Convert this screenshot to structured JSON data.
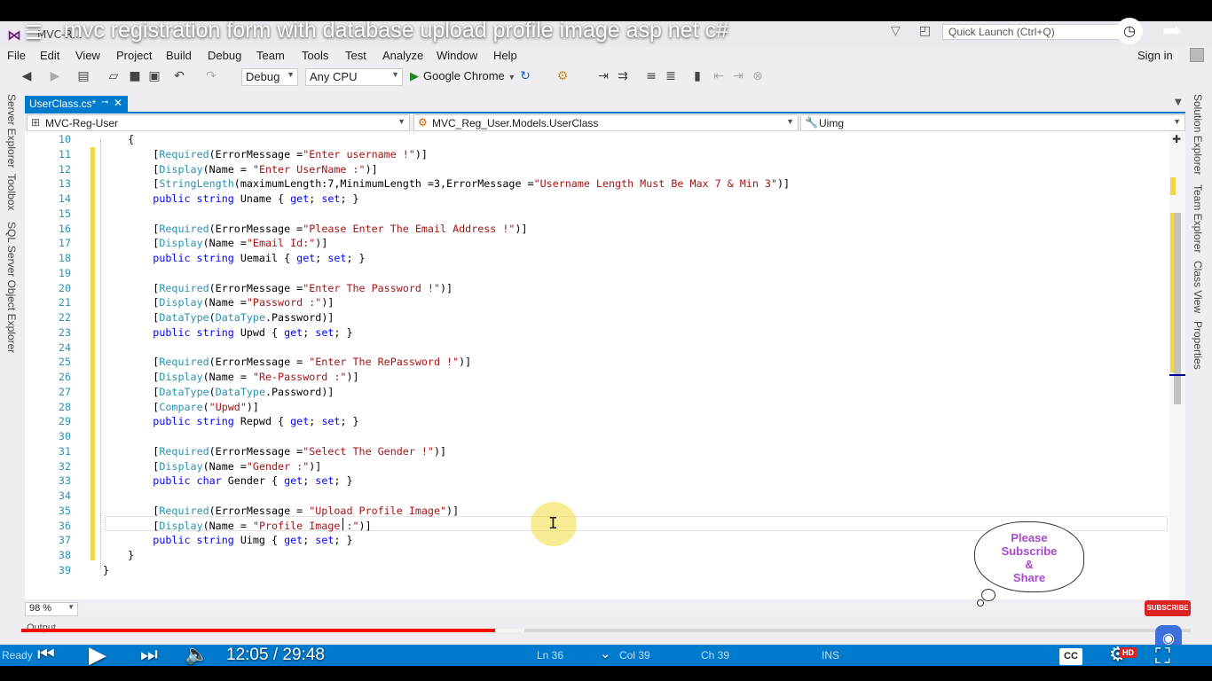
{
  "video": {
    "title": "mvc registration form with database upload profile image asp net c#",
    "current_time": "12:05",
    "duration": "29:48",
    "time_display": "12:05 / 29:48",
    "progress_fraction": 0.4055,
    "buffered_fraction": 0.43,
    "hd_label": "HD",
    "cc_label": "CC",
    "subscribe_label": "SUBSCRIBE"
  },
  "window": {
    "title_fragment": "MVC-R...",
    "quick_launch_placeholder": "Quick Launch (Ctrl+Q)",
    "sign_in": "Sign in"
  },
  "menu": [
    "File",
    "Edit",
    "View",
    "Project",
    "Build",
    "Debug",
    "Team",
    "Tools",
    "Test",
    "Analyze",
    "Window",
    "Help"
  ],
  "toolbar": {
    "config": "Debug",
    "platform": "Any CPU",
    "run_target": "Google Chrome"
  },
  "left_tabs": [
    "Server Explorer",
    "Toolbox",
    "SQL Server Object Explorer"
  ],
  "right_tabs": [
    "Solution Explorer",
    "Team Explorer",
    "Class View",
    "Properties"
  ],
  "document_tab": {
    "label": "UserClass.cs*"
  },
  "navigation_bar": {
    "project": "MVC-Reg-User",
    "type": "MVC_Reg_User.Models.UserClass",
    "member": "Uimg"
  },
  "code_lines": [
    {
      "n": "10",
      "tokens": [
        {
          "t": "tx",
          "v": "    {"
        }
      ]
    },
    {
      "n": "11",
      "tokens": [
        {
          "t": "tx",
          "v": "        ["
        },
        {
          "t": "ty",
          "v": "Required"
        },
        {
          "t": "tx",
          "v": "(ErrorMessage ="
        },
        {
          "t": "st",
          "v": "\"Enter username !\""
        },
        {
          "t": "tx",
          "v": ")]"
        }
      ]
    },
    {
      "n": "12",
      "tokens": [
        {
          "t": "tx",
          "v": "        ["
        },
        {
          "t": "ty",
          "v": "Display"
        },
        {
          "t": "tx",
          "v": "(Name = "
        },
        {
          "t": "st",
          "v": "\"Enter UserName :\""
        },
        {
          "t": "tx",
          "v": ")]"
        }
      ]
    },
    {
      "n": "13",
      "tokens": [
        {
          "t": "tx",
          "v": "        ["
        },
        {
          "t": "ty",
          "v": "StringLength"
        },
        {
          "t": "tx",
          "v": "(maximumLength:7,MinimumLength =3,ErrorMessage ="
        },
        {
          "t": "st",
          "v": "\"Username Length Must Be Max 7 & Min 3\""
        },
        {
          "t": "tx",
          "v": ")]"
        }
      ]
    },
    {
      "n": "14",
      "tokens": [
        {
          "t": "tx",
          "v": "        "
        },
        {
          "t": "kw",
          "v": "public string"
        },
        {
          "t": "tx",
          "v": " Uname { "
        },
        {
          "t": "kw",
          "v": "get"
        },
        {
          "t": "tx",
          "v": "; "
        },
        {
          "t": "kw",
          "v": "set"
        },
        {
          "t": "tx",
          "v": "; }"
        }
      ]
    },
    {
      "n": "15",
      "tokens": []
    },
    {
      "n": "16",
      "tokens": [
        {
          "t": "tx",
          "v": "        ["
        },
        {
          "t": "ty",
          "v": "Required"
        },
        {
          "t": "tx",
          "v": "(ErrorMessage ="
        },
        {
          "t": "st",
          "v": "\"Please Enter The Email Address !\""
        },
        {
          "t": "tx",
          "v": ")]"
        }
      ]
    },
    {
      "n": "17",
      "tokens": [
        {
          "t": "tx",
          "v": "        ["
        },
        {
          "t": "ty",
          "v": "Display"
        },
        {
          "t": "tx",
          "v": "(Name ="
        },
        {
          "t": "st",
          "v": "\"Email Id:\""
        },
        {
          "t": "tx",
          "v": ")]"
        }
      ]
    },
    {
      "n": "18",
      "tokens": [
        {
          "t": "tx",
          "v": "        "
        },
        {
          "t": "kw",
          "v": "public string"
        },
        {
          "t": "tx",
          "v": " Uemail { "
        },
        {
          "t": "kw",
          "v": "get"
        },
        {
          "t": "tx",
          "v": "; "
        },
        {
          "t": "kw",
          "v": "set"
        },
        {
          "t": "tx",
          "v": "; }"
        }
      ]
    },
    {
      "n": "19",
      "tokens": []
    },
    {
      "n": "20",
      "tokens": [
        {
          "t": "tx",
          "v": "        ["
        },
        {
          "t": "ty",
          "v": "Required"
        },
        {
          "t": "tx",
          "v": "(ErrorMessage ="
        },
        {
          "t": "st",
          "v": "\"Enter The Password !\""
        },
        {
          "t": "tx",
          "v": ")]"
        }
      ]
    },
    {
      "n": "21",
      "tokens": [
        {
          "t": "tx",
          "v": "        ["
        },
        {
          "t": "ty",
          "v": "Display"
        },
        {
          "t": "tx",
          "v": "(Name ="
        },
        {
          "t": "st",
          "v": "\"Password :\""
        },
        {
          "t": "tx",
          "v": ")]"
        }
      ]
    },
    {
      "n": "22",
      "tokens": [
        {
          "t": "tx",
          "v": "        ["
        },
        {
          "t": "ty",
          "v": "DataType"
        },
        {
          "t": "tx",
          "v": "("
        },
        {
          "t": "ty",
          "v": "DataType"
        },
        {
          "t": "tx",
          "v": ".Password)]"
        }
      ]
    },
    {
      "n": "23",
      "tokens": [
        {
          "t": "tx",
          "v": "        "
        },
        {
          "t": "kw",
          "v": "public string"
        },
        {
          "t": "tx",
          "v": " Upwd { "
        },
        {
          "t": "kw",
          "v": "get"
        },
        {
          "t": "tx",
          "v": "; "
        },
        {
          "t": "kw",
          "v": "set"
        },
        {
          "t": "tx",
          "v": "; }"
        }
      ]
    },
    {
      "n": "24",
      "tokens": []
    },
    {
      "n": "25",
      "tokens": [
        {
          "t": "tx",
          "v": "        ["
        },
        {
          "t": "ty",
          "v": "Required"
        },
        {
          "t": "tx",
          "v": "(ErrorMessage = "
        },
        {
          "t": "st",
          "v": "\"Enter The RePassword !\""
        },
        {
          "t": "tx",
          "v": ")]"
        }
      ]
    },
    {
      "n": "26",
      "tokens": [
        {
          "t": "tx",
          "v": "        ["
        },
        {
          "t": "ty",
          "v": "Display"
        },
        {
          "t": "tx",
          "v": "(Name = "
        },
        {
          "t": "st",
          "v": "\"Re-Password :\""
        },
        {
          "t": "tx",
          "v": ")]"
        }
      ]
    },
    {
      "n": "27",
      "tokens": [
        {
          "t": "tx",
          "v": "        ["
        },
        {
          "t": "ty",
          "v": "DataType"
        },
        {
          "t": "tx",
          "v": "("
        },
        {
          "t": "ty",
          "v": "DataType"
        },
        {
          "t": "tx",
          "v": ".Password)]"
        }
      ]
    },
    {
      "n": "28",
      "tokens": [
        {
          "t": "tx",
          "v": "        ["
        },
        {
          "t": "ty",
          "v": "Compare"
        },
        {
          "t": "tx",
          "v": "("
        },
        {
          "t": "st",
          "v": "\"Upwd\""
        },
        {
          "t": "tx",
          "v": ")]"
        }
      ]
    },
    {
      "n": "29",
      "tokens": [
        {
          "t": "tx",
          "v": "        "
        },
        {
          "t": "kw",
          "v": "public string"
        },
        {
          "t": "tx",
          "v": " Repwd { "
        },
        {
          "t": "kw",
          "v": "get"
        },
        {
          "t": "tx",
          "v": "; "
        },
        {
          "t": "kw",
          "v": "set"
        },
        {
          "t": "tx",
          "v": "; }"
        }
      ]
    },
    {
      "n": "30",
      "tokens": []
    },
    {
      "n": "31",
      "tokens": [
        {
          "t": "tx",
          "v": "        ["
        },
        {
          "t": "ty",
          "v": "Required"
        },
        {
          "t": "tx",
          "v": "(ErrorMessage ="
        },
        {
          "t": "st",
          "v": "\"Select The Gender !\""
        },
        {
          "t": "tx",
          "v": ")]"
        }
      ]
    },
    {
      "n": "32",
      "tokens": [
        {
          "t": "tx",
          "v": "        ["
        },
        {
          "t": "ty",
          "v": "Display"
        },
        {
          "t": "tx",
          "v": "(Name ="
        },
        {
          "t": "st",
          "v": "\"Gender :\""
        },
        {
          "t": "tx",
          "v": ")]"
        }
      ]
    },
    {
      "n": "33",
      "tokens": [
        {
          "t": "tx",
          "v": "        "
        },
        {
          "t": "kw",
          "v": "public char"
        },
        {
          "t": "tx",
          "v": " Gender { "
        },
        {
          "t": "kw",
          "v": "get"
        },
        {
          "t": "tx",
          "v": "; "
        },
        {
          "t": "kw",
          "v": "set"
        },
        {
          "t": "tx",
          "v": "; }"
        }
      ]
    },
    {
      "n": "34",
      "tokens": []
    },
    {
      "n": "35",
      "tokens": [
        {
          "t": "tx",
          "v": "        ["
        },
        {
          "t": "ty",
          "v": "Required"
        },
        {
          "t": "tx",
          "v": "(ErrorMessage = "
        },
        {
          "t": "st",
          "v": "\"Upload Profile Image\""
        },
        {
          "t": "tx",
          "v": ")]"
        }
      ]
    },
    {
      "n": "36",
      "tokens": [
        {
          "t": "tx",
          "v": "        ["
        },
        {
          "t": "ty",
          "v": "Display"
        },
        {
          "t": "tx",
          "v": "(Name = "
        },
        {
          "t": "st",
          "v": "\"Profile Image :\""
        },
        {
          "t": "tx",
          "v": ")]"
        }
      ]
    },
    {
      "n": "37",
      "tokens": [
        {
          "t": "tx",
          "v": "        "
        },
        {
          "t": "kw",
          "v": "public string"
        },
        {
          "t": "tx",
          "v": " Uimg { "
        },
        {
          "t": "kw",
          "v": "get"
        },
        {
          "t": "tx",
          "v": "; "
        },
        {
          "t": "kw",
          "v": "set"
        },
        {
          "t": "tx",
          "v": "; }"
        }
      ]
    },
    {
      "n": "38",
      "tokens": [
        {
          "t": "tx",
          "v": "    }"
        }
      ]
    },
    {
      "n": "39",
      "tokens": [
        {
          "t": "tx",
          "v": "}"
        }
      ]
    }
  ],
  "editor": {
    "zoom": "98 %"
  },
  "bubble": {
    "lines": [
      "Please",
      "Subscribe",
      "&",
      "Share"
    ]
  },
  "output_label": "Output",
  "status": {
    "ready": "Ready",
    "ln": "Ln 36",
    "col": "Col 39",
    "ch": "Ch 39",
    "ins": "INS"
  },
  "colors": {
    "accent": "#007acc",
    "keyword": "#0000ff",
    "type": "#2b91af",
    "string": "#a31515",
    "progress": "#ff0000"
  }
}
